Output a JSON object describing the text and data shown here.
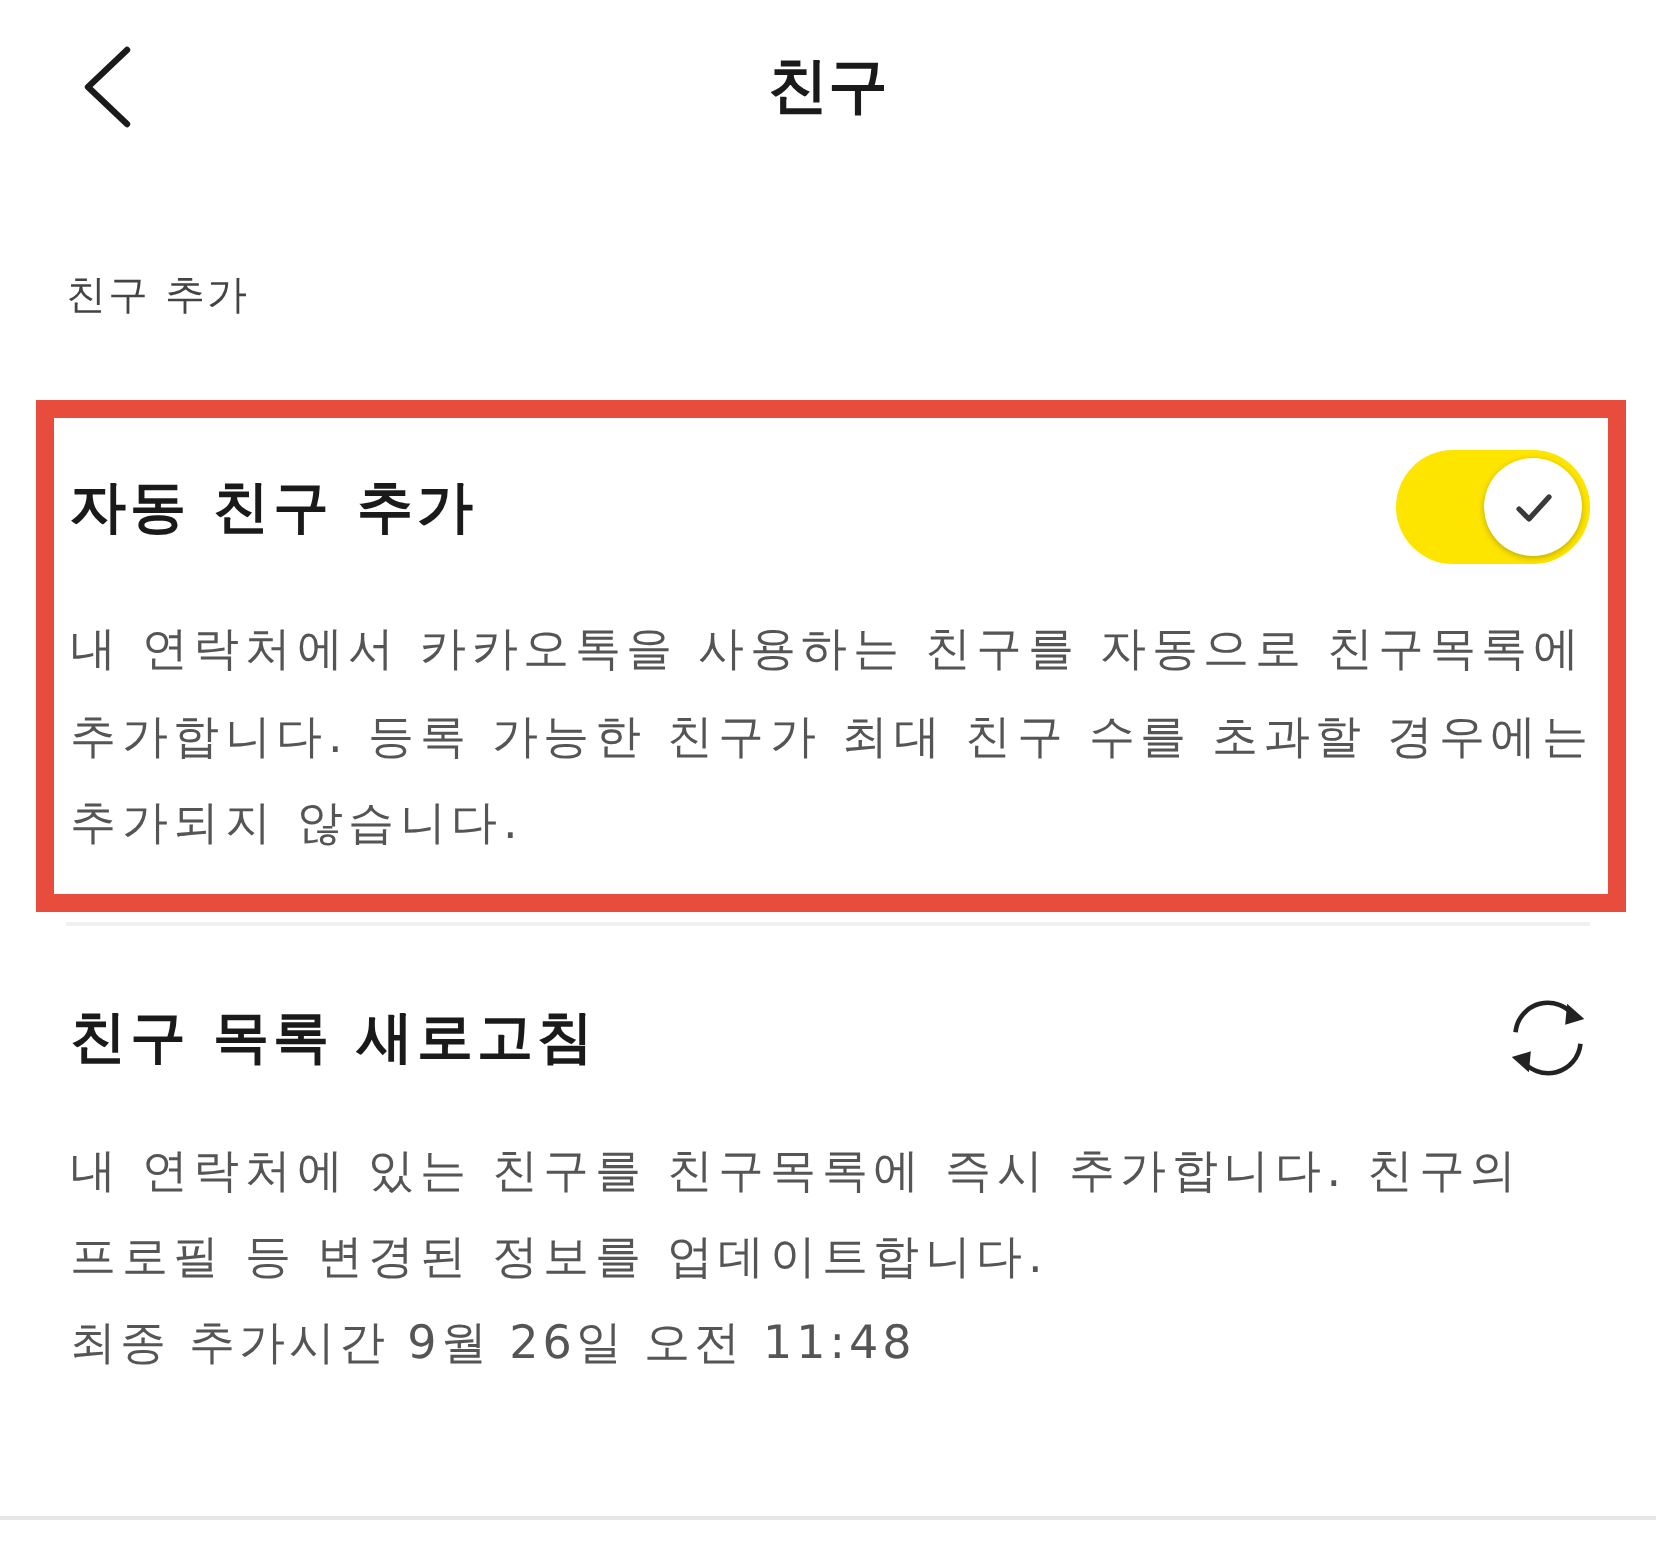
{
  "header": {
    "title": "친구"
  },
  "section": {
    "label": "친구 추가"
  },
  "settings": [
    {
      "kind": "toggle",
      "title": "자동 친구 추가",
      "description": "내 연락처에서 카카오톡을 사용하는 친구를 자동으로 친구목록에 추가합니다. 등록 가능한 친구가 최대 친구 수를 초과할 경우에는 추가되지 않습니다.",
      "on": true,
      "highlighted": true
    },
    {
      "kind": "refresh",
      "title": "친구 목록 새로고침",
      "description": "내 연락처에 있는 친구를 친구목록에 즉시 추가합니다. 친구의 프로필 등 변경된 정보를 업데이트합니다.",
      "last_updated": "최종 추가시간 9월 26일 오전 11:48",
      "highlighted": false
    }
  ]
}
